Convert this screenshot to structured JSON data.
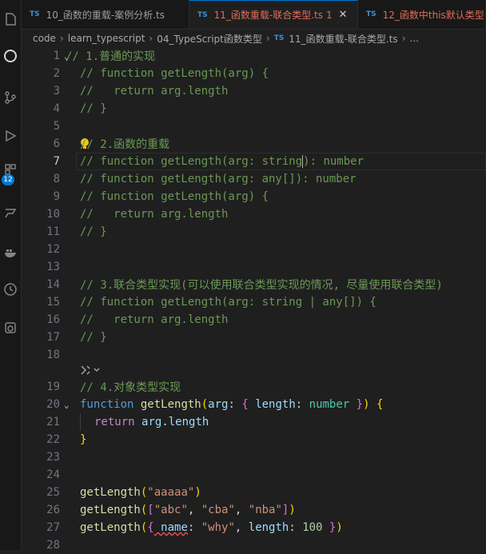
{
  "tabs": [
    {
      "ts": "TS",
      "label": "10_函数的重载-案例分析.ts"
    },
    {
      "ts": "TS",
      "label": "11_函数重载-联合类型.ts",
      "modified": "1",
      "close": "✕"
    },
    {
      "ts": "TS",
      "label": "12_函数中this默认类型"
    }
  ],
  "breadcrumb": {
    "items": [
      "code",
      "learn_typescript",
      "04_TypeScript函数类型"
    ],
    "file_ts": "TS",
    "file": "11_函数重载-联合类型.ts",
    "tail": "..."
  },
  "badge": "12",
  "lines": {
    "l1": "// 1.普通的实现",
    "l2": "// function getLength(arg) {",
    "l3": "//   return arg.length",
    "l4": "// }",
    "l6": "// 2.函数的重载",
    "l7a": "// function getLength(arg: string",
    "l7b": "): number",
    "l8": "// function getLength(arg: any[]): number",
    "l9": "// function getLength(arg) {",
    "l10": "//   return arg.length",
    "l11": "// }",
    "l14": "// 3.联合类型实现(可以使用联合类型实现的情况, 尽量使用联合类型)",
    "l15": "// function getLength(arg: string | any[]) {",
    "l16": "//   return arg.length",
    "l17": "// }",
    "l19": "// 4.对象类型实现",
    "l20": {
      "kw": "function",
      "fn": "getLength",
      "p1": "(",
      "arg": "arg",
      "c1": ": ",
      "b": "{",
      "len": " length",
      "c2": ": ",
      "ty": "number",
      "be": " }",
      "p2": ")",
      "sp": " ",
      "ob": "{"
    },
    "l21": {
      "kw": "return",
      "obj": "arg",
      "dot": ".",
      "prop": "length"
    },
    "l22": "}",
    "l25": {
      "fn": "getLength",
      "p1": "(",
      "s": "\"aaaaa\"",
      "p2": ")"
    },
    "l26": {
      "fn": "getLength",
      "p1": "(",
      "br1": "[",
      "s1": "\"abc\"",
      "cm1": ", ",
      "s2": "\"cba\"",
      "cm2": ", ",
      "s3": "\"nba\"",
      "br2": "]",
      "p2": ")"
    },
    "l27": {
      "fn": "getLength",
      "p1": "(",
      "ob": "{",
      "k1": " name",
      "c1": ": ",
      "s": "\"why\"",
      "cm": ", ",
      "k2": "length",
      "c2": ": ",
      "n": "100",
      "cb": " }",
      "p2": ")"
    }
  },
  "line_numbers": [
    "1",
    "2",
    "3",
    "4",
    "5",
    "6",
    "7",
    "8",
    "9",
    "10",
    "11",
    "12",
    "13",
    "14",
    "15",
    "16",
    "17",
    "18",
    "19",
    "20",
    "21",
    "22",
    "23",
    "24",
    "25",
    "26",
    "27",
    "28"
  ]
}
